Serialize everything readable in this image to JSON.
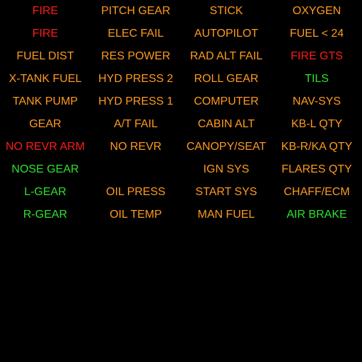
{
  "colors": {
    "warning": "#ff1a1a",
    "caution": "#ff9a1f",
    "advisory": "#2ee22e",
    "background": "#000000"
  },
  "rows": [
    [
      {
        "label": "FIRE",
        "level": "warning"
      },
      {
        "label": "PITCH GEAR",
        "level": "caution"
      },
      {
        "label": "STICK",
        "level": "caution"
      },
      {
        "label": "OXYGEN",
        "level": "caution"
      }
    ],
    [
      {
        "label": "FIRE",
        "level": "warning"
      },
      {
        "label": "ELEC FAIL",
        "level": "caution"
      },
      {
        "label": "AUTOPILOT",
        "level": "caution"
      },
      {
        "label": "FUEL < 24",
        "level": "caution"
      }
    ],
    [
      {
        "label": "FUEL DIST",
        "level": "caution"
      },
      {
        "label": "RES POWER",
        "level": "caution"
      },
      {
        "label": "RAD ALT FAIL",
        "level": "caution"
      },
      {
        "label": "FIRE GTS",
        "level": "warning"
      }
    ],
    [
      {
        "label": "X-TANK FUEL",
        "level": "caution"
      },
      {
        "label": "HYD PRESS 2",
        "level": "caution"
      },
      {
        "label": "ROLL GEAR",
        "level": "caution"
      },
      {
        "label": "TILS",
        "level": "advisory"
      }
    ],
    [
      {
        "label": "TANK PUMP",
        "level": "caution"
      },
      {
        "label": "HYD PRESS 1",
        "level": "caution"
      },
      {
        "label": "COMPUTER",
        "level": "caution"
      },
      {
        "label": "NAV-SYS",
        "level": "caution"
      }
    ],
    [
      {
        "label": "GEAR",
        "level": "caution"
      },
      {
        "label": "A/T FAIL",
        "level": "caution"
      },
      {
        "label": "CABIN ALT",
        "level": "caution"
      },
      {
        "label": "KB-L QTY",
        "level": "caution"
      }
    ],
    [
      {
        "label": "NO REVR ARM",
        "level": "warning"
      },
      {
        "label": "NO REVR",
        "level": "caution"
      },
      {
        "label": "CANOPY/SEAT",
        "level": "caution"
      },
      {
        "label": "KB-R/KA QTY",
        "level": "caution"
      }
    ],
    [
      {
        "label": "NOSE GEAR",
        "level": "advisory"
      },
      {
        "label": "",
        "level": "empty"
      },
      {
        "label": "IGN SYS",
        "level": "caution"
      },
      {
        "label": "FLARES QTY",
        "level": "caution"
      }
    ],
    [
      {
        "label": "L-GEAR",
        "level": "advisory"
      },
      {
        "label": "OIL PRESS",
        "level": "caution"
      },
      {
        "label": "START SYS",
        "level": "caution"
      },
      {
        "label": "CHAFF/ECM",
        "level": "caution"
      }
    ],
    [
      {
        "label": "R-GEAR",
        "level": "advisory"
      },
      {
        "label": "OIL TEMP",
        "level": "caution"
      },
      {
        "label": "MAN FUEL",
        "level": "caution"
      },
      {
        "label": "AIR BRAKE",
        "level": "advisory"
      }
    ]
  ]
}
